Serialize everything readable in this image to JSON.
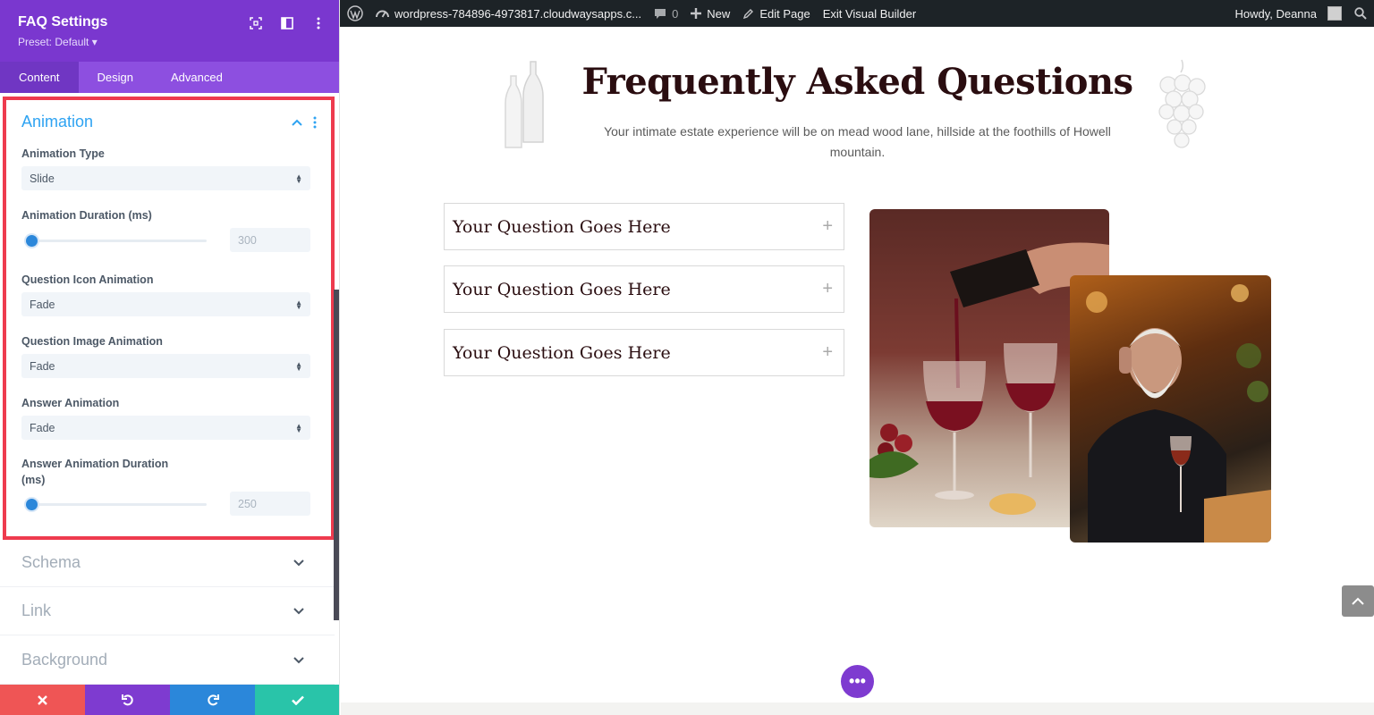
{
  "panel": {
    "title": "FAQ Settings",
    "preset": "Preset: Default ▾",
    "tabs": [
      {
        "label": "Content",
        "active": true
      },
      {
        "label": "Design",
        "active": false
      },
      {
        "label": "Advanced",
        "active": false
      }
    ],
    "animation": {
      "title": "Animation",
      "fields": {
        "animation_type": {
          "label": "Animation Type",
          "value": "Slide"
        },
        "animation_duration": {
          "label": "Animation Duration (ms)",
          "value": "300"
        },
        "question_icon_animation": {
          "label": "Question Icon Animation",
          "value": "Fade"
        },
        "question_image_animation": {
          "label": "Question Image Animation",
          "value": "Fade"
        },
        "answer_animation": {
          "label": "Answer Animation",
          "value": "Fade"
        },
        "answer_animation_duration": {
          "label_line1": "Answer Animation Duration",
          "label_line2": "(ms)",
          "value": "250"
        }
      }
    },
    "sections": [
      "Schema",
      "Link",
      "Background"
    ],
    "colors": {
      "accent": "#7a37cf",
      "highlight": "#ee3b4e",
      "link_blue": "#2ea3f2"
    }
  },
  "adminbar": {
    "site": "wordpress-784896-4973817.cloudwaysapps.c...",
    "comments": "0",
    "new": "New",
    "edit_page": "Edit Page",
    "exit_builder": "Exit Visual Builder",
    "howdy": "Howdy, Deanna"
  },
  "page": {
    "title": "Frequently Asked Questions",
    "subtitle": "Your intimate estate experience will be on mead wood lane, hillside at the foothills of Howell mountain.",
    "questions": [
      "Your Question Goes Here",
      "Your Question Goes Here",
      "Your Question Goes Here"
    ],
    "dots": "•••"
  }
}
